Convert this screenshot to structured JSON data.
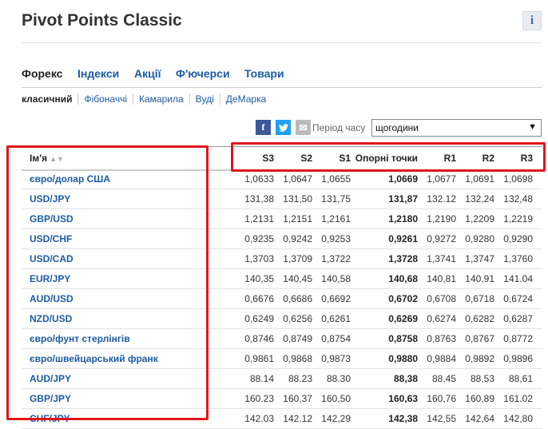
{
  "header": {
    "title": "Pivot Points Classic",
    "info_label": "i"
  },
  "tabs": [
    {
      "label": "Форекс",
      "active": true
    },
    {
      "label": "Індекси",
      "active": false
    },
    {
      "label": "Акції",
      "active": false
    },
    {
      "label": "Ф'ючерси",
      "active": false
    },
    {
      "label": "Товари",
      "active": false
    }
  ],
  "subtabs": [
    {
      "label": "класичний",
      "active": true
    },
    {
      "label": "Фібоначчі",
      "active": false
    },
    {
      "label": "Камарила",
      "active": false
    },
    {
      "label": "Вуді",
      "active": false
    },
    {
      "label": "ДеМарка",
      "active": false
    }
  ],
  "share": {
    "facebook": "f",
    "twitter": "t",
    "mail": "✉"
  },
  "period": {
    "label": "Період часу",
    "selected": "щогодини"
  },
  "table": {
    "columns": {
      "name": "Ім'я",
      "s3": "S3",
      "s2": "S2",
      "s1": "S1",
      "pivot": "Опорні точки",
      "r1": "R1",
      "r2": "R2",
      "r3": "R3"
    },
    "rows": [
      {
        "name": "євро/долар США",
        "s3": "1,0633",
        "s2": "1,0647",
        "s1": "1,0655",
        "pivot": "1,0669",
        "r1": "1,0677",
        "r2": "1,0691",
        "r3": "1,0698"
      },
      {
        "name": "USD/JPY",
        "s3": "131,38",
        "s2": "131,50",
        "s1": "131,75",
        "pivot": "131,87",
        "r1": "132.12",
        "r2": "132,24",
        "r3": "132,48"
      },
      {
        "name": "GBP/USD",
        "s3": "1,2131",
        "s2": "1,2151",
        "s1": "1,2161",
        "pivot": "1,2180",
        "r1": "1,2190",
        "r2": "1,2209",
        "r3": "1,2219"
      },
      {
        "name": "USD/CHF",
        "s3": "0,9235",
        "s2": "0,9242",
        "s1": "0,9253",
        "pivot": "0,9261",
        "r1": "0,9272",
        "r2": "0,9280",
        "r3": "0,9290"
      },
      {
        "name": "USD/CAD",
        "s3": "1,3703",
        "s2": "1,3709",
        "s1": "1,3722",
        "pivot": "1,3728",
        "r1": "1,3741",
        "r2": "1,3747",
        "r3": "1,3760"
      },
      {
        "name": "EUR/JPY",
        "s3": "140,35",
        "s2": "140,45",
        "s1": "140,58",
        "pivot": "140,68",
        "r1": "140,81",
        "r2": "140,91",
        "r3": "141.04"
      },
      {
        "name": "AUD/USD",
        "s3": "0,6676",
        "s2": "0,6686",
        "s1": "0,6692",
        "pivot": "0,6702",
        "r1": "0,6708",
        "r2": "0,6718",
        "r3": "0,6724"
      },
      {
        "name": "NZD/USD",
        "s3": "0,6249",
        "s2": "0,6256",
        "s1": "0,6261",
        "pivot": "0,6269",
        "r1": "0,6274",
        "r2": "0,6282",
        "r3": "0,6287"
      },
      {
        "name": "євро/фунт стерлінгів",
        "s3": "0,8746",
        "s2": "0,8749",
        "s1": "0,8754",
        "pivot": "0,8758",
        "r1": "0,8763",
        "r2": "0,8767",
        "r3": "0,8772"
      },
      {
        "name": "євро/швейцарський франк",
        "s3": "0,9861",
        "s2": "0,9868",
        "s1": "0,9873",
        "pivot": "0,9880",
        "r1": "0,9884",
        "r2": "0,9892",
        "r3": "0,9896"
      },
      {
        "name": "AUD/JPY",
        "s3": "88.14",
        "s2": "88.23",
        "s1": "88.30",
        "pivot": "88,38",
        "r1": "88,45",
        "r2": "88,53",
        "r3": "88,61"
      },
      {
        "name": "GBP/JPY",
        "s3": "160.23",
        "s2": "160,37",
        "s1": "160,50",
        "pivot": "160,63",
        "r1": "160,76",
        "r2": "160,89",
        "r3": "161.02"
      },
      {
        "name": "CHF/JPY",
        "s3": "142.03",
        "s2": "142.12",
        "s1": "142,29",
        "pivot": "142,38",
        "r1": "142,55",
        "r2": "142,64",
        "r3": "142,80"
      }
    ]
  },
  "colors": {
    "link": "#1d5ba2",
    "highlight": "#e0161b"
  }
}
